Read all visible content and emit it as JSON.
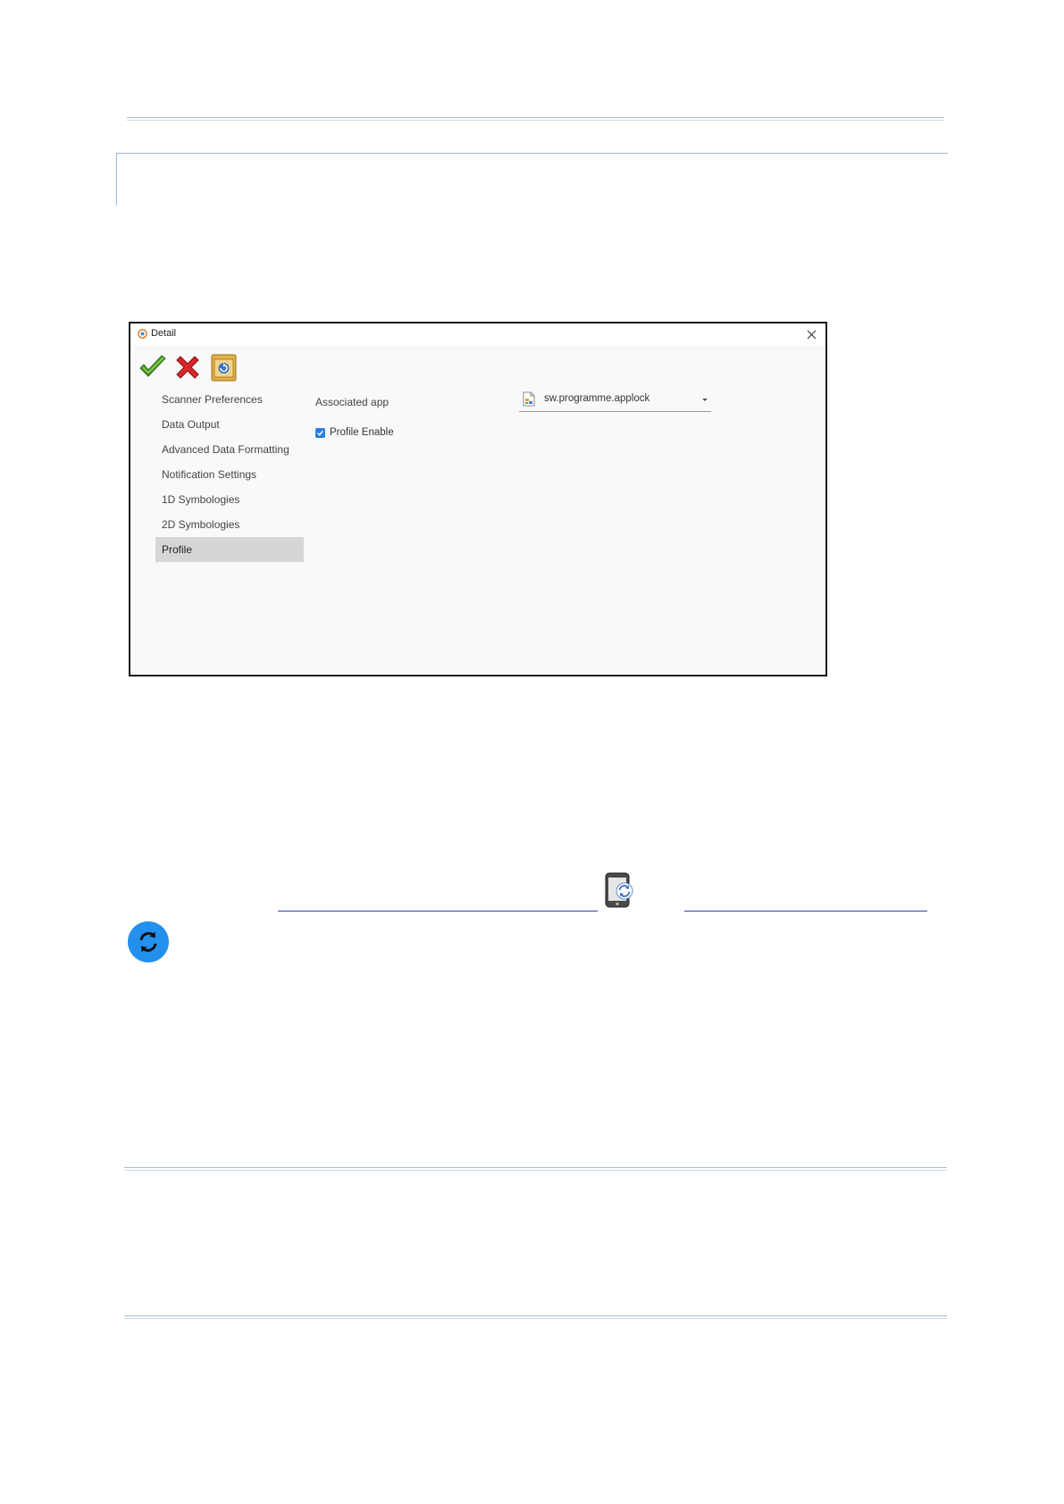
{
  "dialog": {
    "title": "Detail",
    "toolbar": {
      "confirm_icon": "check-icon",
      "cancel_icon": "cross-icon",
      "restore_icon": "restore-icon"
    },
    "nav": [
      {
        "label": "Scanner Preferences",
        "active": false
      },
      {
        "label": "Data Output",
        "active": false
      },
      {
        "label": "Advanced Data Formatting",
        "active": false
      },
      {
        "label": "Notification Settings",
        "active": false
      },
      {
        "label": "1D Symbologies",
        "active": false
      },
      {
        "label": "2D Symbologies",
        "active": false
      },
      {
        "label": "Profile",
        "active": true
      }
    ],
    "profile": {
      "associated_app_label": "Associated app",
      "associated_app_value": "sw.programme.applock",
      "profile_enable_label": "Profile Enable",
      "profile_enable_checked": true
    }
  },
  "colors": {
    "accent": "#2b7de0",
    "link": "#2f3fb8",
    "sync_button": "#2490ee",
    "active_nav": "#d6d6d6"
  },
  "icons": {
    "device_sync": "device-sync-icon",
    "sync_button": "sync-button-icon"
  }
}
